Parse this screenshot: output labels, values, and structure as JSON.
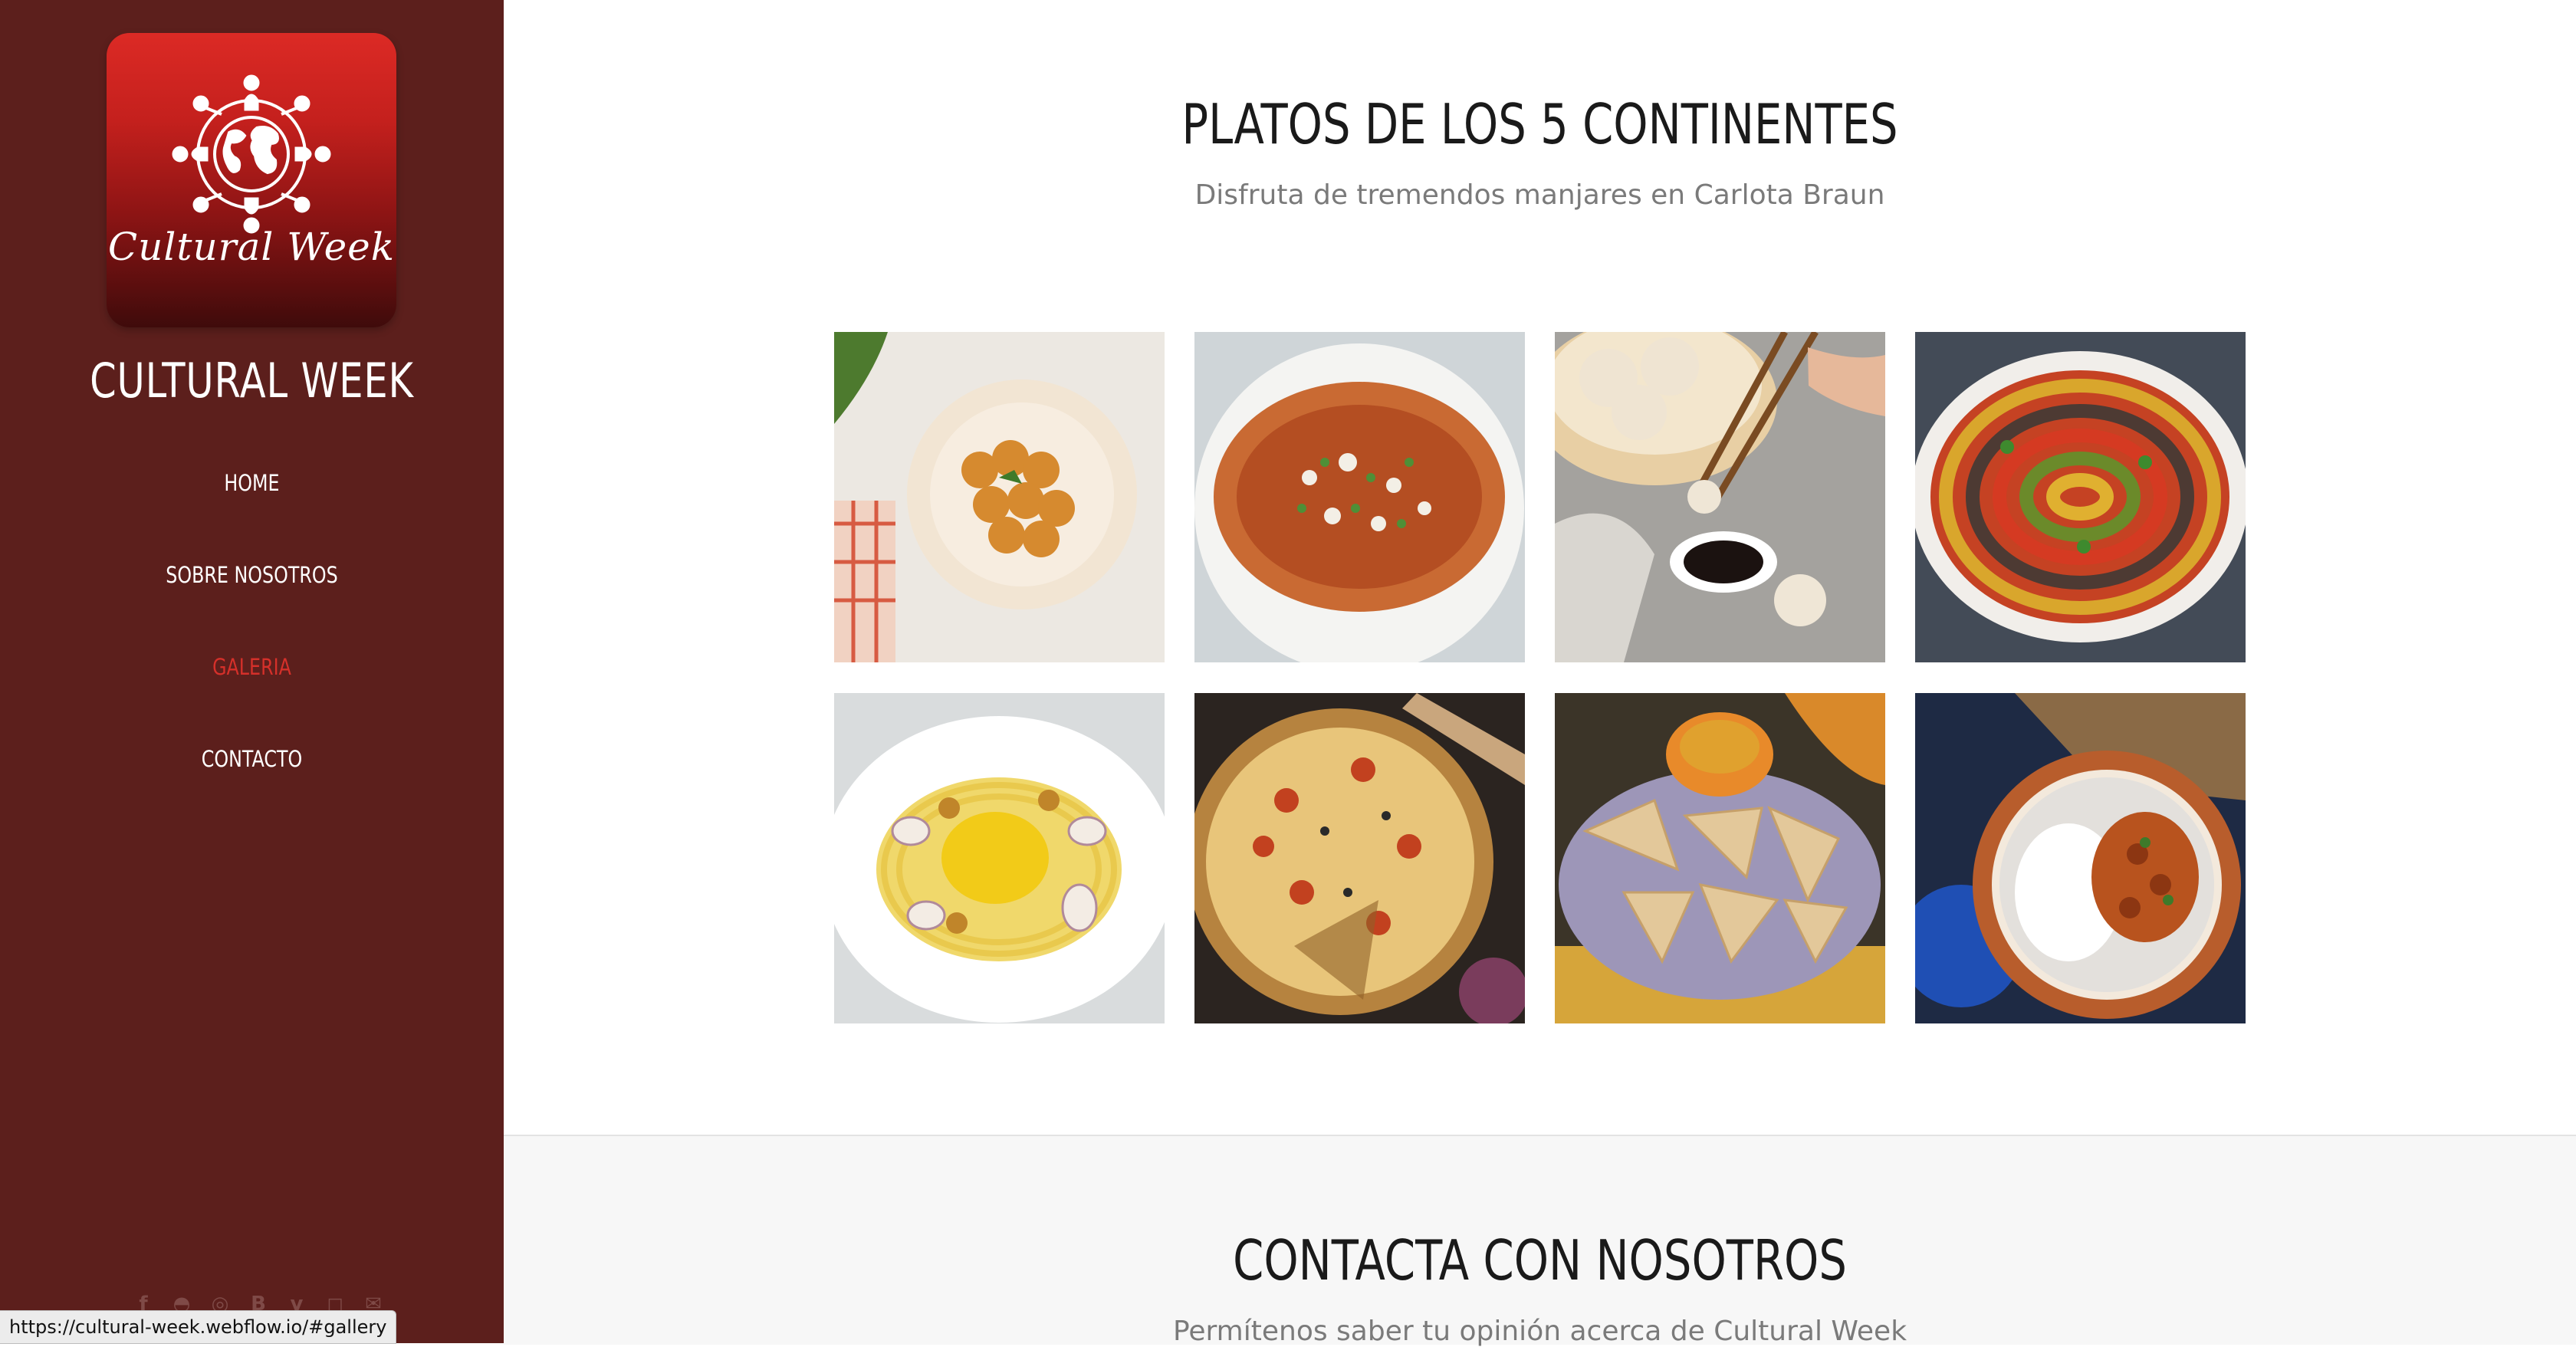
{
  "brand": {
    "logo_script": "Cultural Week",
    "name": "CULTURAL WEEK"
  },
  "nav": {
    "items": [
      {
        "label": "HOME",
        "active": false
      },
      {
        "label": "SOBRE NOSOTROS",
        "active": false
      },
      {
        "label": "GALERIA",
        "active": true
      },
      {
        "label": "CONTACTO",
        "active": false
      }
    ],
    "active_color": "#d5302a"
  },
  "social_icons": [
    "facebook-icon",
    "github-icon",
    "dribbble-icon",
    "behance-icon",
    "vimeo-icon",
    "instagram-icon",
    "email-icon"
  ],
  "status_bar": {
    "url": "https://cultural-week.webflow.io/#gallery"
  },
  "gallery": {
    "title": "PLATOS DE LOS 5 CONTINENTES",
    "subtitle": "Disfruta de tremendos manjares en Carlota Braun",
    "images": [
      {
        "dish": "fried-croquettes"
      },
      {
        "dish": "chilaquiles"
      },
      {
        "dish": "steamed-buns-with-chopsticks"
      },
      {
        "dish": "ratatouille"
      },
      {
        "dish": "pasta-with-squid"
      },
      {
        "dish": "pizza"
      },
      {
        "dish": "scones"
      },
      {
        "dish": "curry-with-rice"
      }
    ]
  },
  "contact": {
    "title": "CONTACTA CON NOSOTROS",
    "subtitle": "Permítenos saber tu opinión acerca de Cultural Week"
  },
  "colors": {
    "sidebar": "#5c1f1c",
    "logo_red": "#dc2a25",
    "accent": "#d5302a",
    "contact_bg": "#f7f7f7"
  }
}
